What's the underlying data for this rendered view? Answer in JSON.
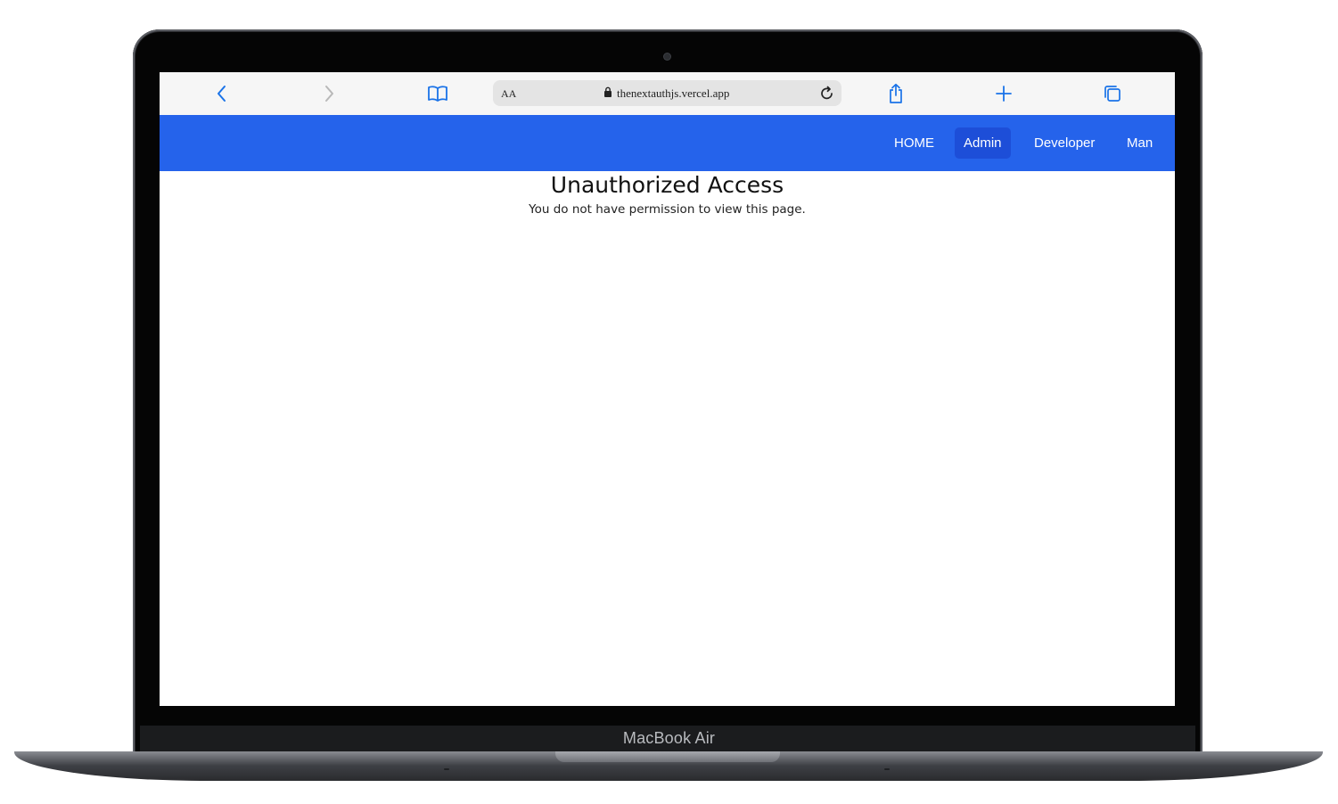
{
  "device": {
    "brand_label": "MacBook Air"
  },
  "browser": {
    "reader_label": "AA",
    "url": "thenextauthjs.vercel.app",
    "icons": {
      "back": "chevron-left-icon",
      "forward": "chevron-right-icon",
      "bookmarks": "book-icon",
      "lock": "lock-icon",
      "reload": "reload-icon",
      "share": "share-icon",
      "new_tab": "plus-icon",
      "tabs": "tabs-icon"
    },
    "accent_color": "#1a73e8"
  },
  "navbar": {
    "background": "#2563eb",
    "active_background": "#1d4ed8",
    "items": [
      {
        "label": "HOME"
      },
      {
        "label": "Admin",
        "active": true
      },
      {
        "label": "Developer"
      },
      {
        "label": "Man"
      }
    ]
  },
  "main": {
    "title": "Unauthorized Access",
    "message": "You do not have permission to view this page."
  }
}
